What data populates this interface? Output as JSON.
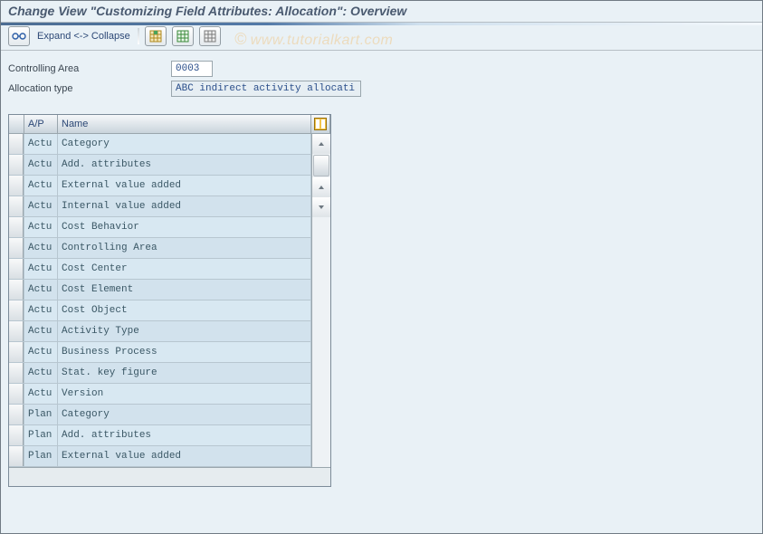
{
  "title": "Change View \"Customizing Field Attributes: Allocation\": Overview",
  "watermark": "www.tutorialkart.com",
  "toolbar": {
    "expand_collapse": "Expand <-> Collapse"
  },
  "form": {
    "controlling_area_label": "Controlling Area",
    "controlling_area_value": "0003",
    "allocation_type_label": "Allocation type",
    "allocation_type_value": "ABC indirect activity allocati"
  },
  "table": {
    "columns": {
      "ap": "A/P",
      "name": "Name"
    },
    "rows": [
      {
        "ap": "Actu",
        "name": "Category"
      },
      {
        "ap": "Actu",
        "name": "Add. attributes"
      },
      {
        "ap": "Actu",
        "name": "External value added"
      },
      {
        "ap": "Actu",
        "name": "Internal value added"
      },
      {
        "ap": "Actu",
        "name": "Cost Behavior"
      },
      {
        "ap": "Actu",
        "name": "Controlling Area"
      },
      {
        "ap": "Actu",
        "name": "Cost Center"
      },
      {
        "ap": "Actu",
        "name": "Cost Element"
      },
      {
        "ap": "Actu",
        "name": "Cost Object"
      },
      {
        "ap": "Actu",
        "name": "Activity Type"
      },
      {
        "ap": "Actu",
        "name": "Business Process"
      },
      {
        "ap": "Actu",
        "name": "Stat. key figure"
      },
      {
        "ap": "Actu",
        "name": "Version"
      },
      {
        "ap": "Plan",
        "name": "Category"
      },
      {
        "ap": "Plan",
        "name": "Add. attributes"
      },
      {
        "ap": "Plan",
        "name": "External value added"
      }
    ]
  }
}
